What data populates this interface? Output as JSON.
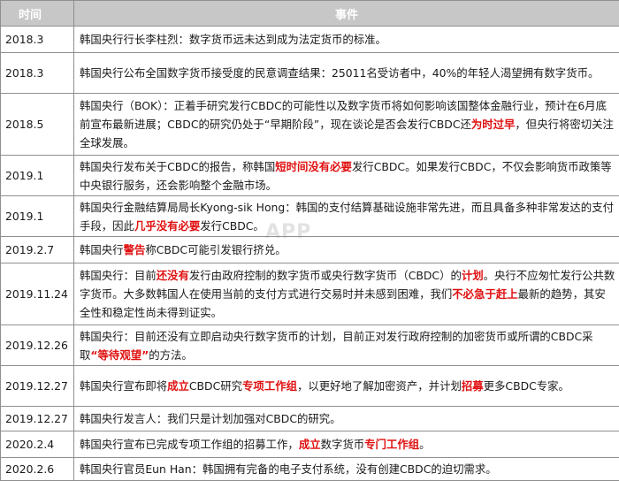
{
  "header": {
    "date": "时间",
    "event": "事件"
  },
  "rows": [
    {
      "date": "2018.3",
      "height": 30,
      "segments": [
        {
          "t": "韩国央行行长李柱烈：数字货币远未达到成为法定货币的标准。",
          "h": false
        }
      ]
    },
    {
      "date": "2018.3",
      "height": 46,
      "segments": [
        {
          "t": "韩国央行公布全国数字货币接受度的民意调查结果：25011名受访者中，40%的年轻人渴望拥有数字货币。",
          "h": false
        }
      ]
    },
    {
      "date": "2018.5",
      "height": 70,
      "segments": [
        {
          "t": "韩国央行（BOK）：正着手研究发行CBDC的可能性以及数字货币将如何影响该国整体金融行业，预计在6月底前宣布最新进展；CBDC的研究仍处于“早期阶段”，现在谈论是否会发行CBDC还",
          "h": false
        },
        {
          "t": "为时过早",
          "h": true
        },
        {
          "t": "，但央行将密切关注全球发展。",
          "h": false
        }
      ]
    },
    {
      "date": "2019.1",
      "height": 46,
      "segments": [
        {
          "t": "韩国央行发布关于CBDC的报告，称韩国",
          "h": false
        },
        {
          "t": "短时间没有必要",
          "h": true
        },
        {
          "t": "发行CBDC。如果发行CBDC，不仅会影响货币政策等中央银行服务，还会影响整个金融市场。",
          "h": false
        }
      ]
    },
    {
      "date": "2019.1",
      "height": 46,
      "segments": [
        {
          "t": "韩国央行金融结算局局长Kyong-sik Hong：韩国的支付结算基础设施非常先进，而且具备多种非常发达的支付手段，因此",
          "h": false
        },
        {
          "t": "几乎没有必要",
          "h": true
        },
        {
          "t": "发行CBDC。",
          "h": false
        }
      ]
    },
    {
      "date": "2019.2.7",
      "height": 30,
      "segments": [
        {
          "t": "韩国央行",
          "h": false
        },
        {
          "t": "警告",
          "h": true
        },
        {
          "t": "称CBDC可能引发银行挤兑。",
          "h": false
        }
      ]
    },
    {
      "date": "2019.11.24",
      "height": 70,
      "segments": [
        {
          "t": "韩国央行：目前",
          "h": false
        },
        {
          "t": "还没有",
          "h": true
        },
        {
          "t": "发行由政府控制的数字货币或央行数字货币（CBDC）的",
          "h": false
        },
        {
          "t": "计划",
          "h": true
        },
        {
          "t": "。央行不应匆忙发行公共数字货币。大多数韩国人在使用当前的支付方式进行交易时并未感到困难，我们",
          "h": false
        },
        {
          "t": "不必急于赶上",
          "h": true
        },
        {
          "t": "最新的趋势，其安全性和稳定性尚未得到证实。",
          "h": false
        }
      ]
    },
    {
      "date": "2019.12.26",
      "height": 46,
      "segments": [
        {
          "t": "韩国央行：目前还没有立即启动央行数字货币的计划，目前正对发行政府控制的加密货币或所谓的CBDC采取",
          "h": false
        },
        {
          "t": "“等待观望”",
          "h": true
        },
        {
          "t": "的方法。",
          "h": false
        }
      ]
    },
    {
      "date": "2019.12.27",
      "height": 46,
      "segments": [
        {
          "t": "韩国央行宣布即将",
          "h": false
        },
        {
          "t": "成立",
          "h": true
        },
        {
          "t": "CBDC研究",
          "h": false
        },
        {
          "t": "专项工作组",
          "h": true
        },
        {
          "t": "，以更好地了解加密资产，并计划",
          "h": false
        },
        {
          "t": "招募",
          "h": true
        },
        {
          "t": "更多CBDC专家。",
          "h": false
        }
      ]
    },
    {
      "date": "2019.12.27",
      "height": 28,
      "segments": [
        {
          "t": "韩国央行发言人：我们只是计划加强对CBDC的研究。",
          "h": false
        }
      ]
    },
    {
      "date": "2020.2.4",
      "height": 30,
      "segments": [
        {
          "t": "韩国央行宣布已完成专项工作组的招募工作，",
          "h": false
        },
        {
          "t": "成立",
          "h": true
        },
        {
          "t": "数字货币",
          "h": false
        },
        {
          "t": "专门工作组",
          "h": true
        },
        {
          "t": "。",
          "h": false
        }
      ]
    },
    {
      "date": "2020.2.6",
      "height": 26,
      "segments": [
        {
          "t": "韩国央行官员Eun Han：韩国拥有完备的电子支付系统，没有创建CBDC的迫切需求。",
          "h": false
        }
      ]
    }
  ],
  "watermark": "APP"
}
